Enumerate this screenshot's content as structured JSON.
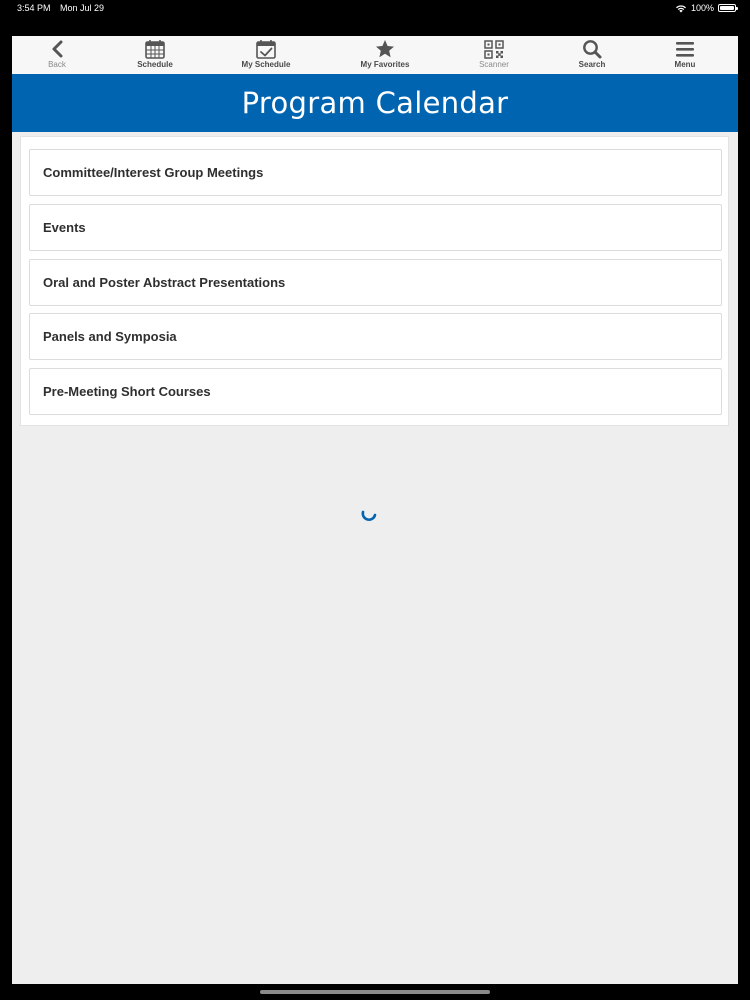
{
  "status": {
    "time": "3:54 PM",
    "date": "Mon Jul 29",
    "battery": "100%",
    "wifi_icon": "wifi-icon",
    "battery_icon": "battery-icon"
  },
  "toolbar": {
    "items": [
      {
        "label": "Back",
        "icon": "chevron-left-icon"
      },
      {
        "label": "Schedule",
        "icon": "calendar-icon"
      },
      {
        "label": "My Schedule",
        "icon": "calendar-check-icon"
      },
      {
        "label": "My Favorites",
        "icon": "star-icon"
      },
      {
        "label": "Scanner",
        "icon": "qr-code-icon"
      },
      {
        "label": "Search",
        "icon": "search-icon"
      },
      {
        "label": "Menu",
        "icon": "hamburger-menu-icon"
      }
    ]
  },
  "header": {
    "title": "Program Calendar"
  },
  "list": {
    "items": [
      {
        "label": "Committee/Interest Group Meetings"
      },
      {
        "label": "Events"
      },
      {
        "label": "Oral and Poster Abstract Presentations"
      },
      {
        "label": "Panels and Symposia"
      },
      {
        "label": "Pre-Meeting Short Courses"
      }
    ]
  },
  "colors": {
    "header_bg": "#0064b1",
    "spinner": "#0064b1",
    "background": "#efeeef"
  },
  "loading_icon": "loading-spinner-icon"
}
